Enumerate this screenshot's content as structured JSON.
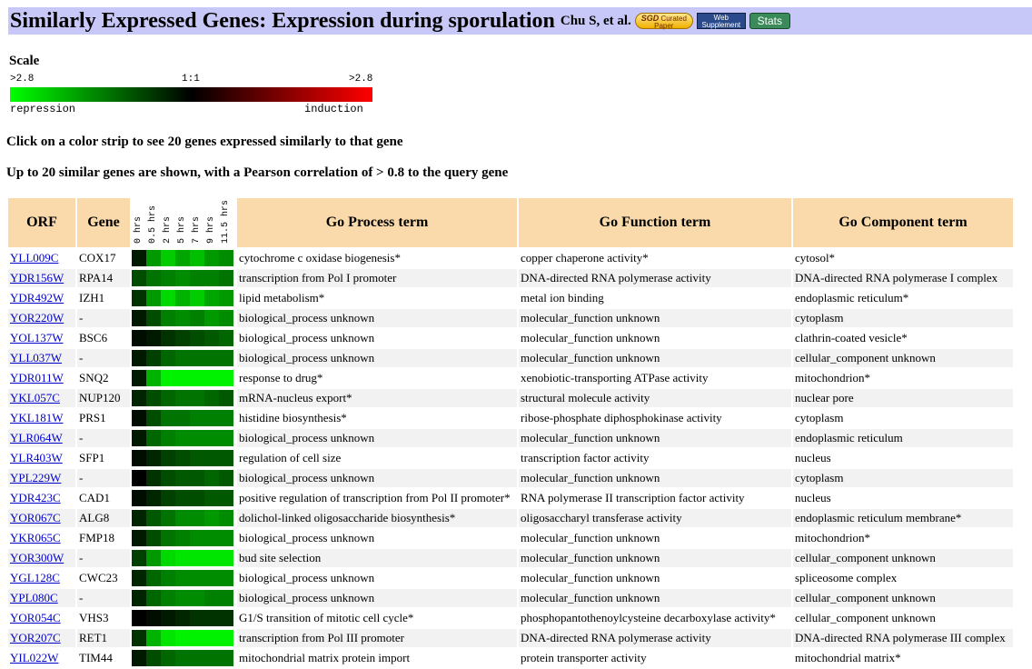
{
  "header": {
    "title": "Similarly Expressed Genes: Expression during sporulation",
    "authors": "Chu S, et al.",
    "sgd_button": {
      "line1": "SGD",
      "line2": "Curated",
      "line3": "Paper"
    },
    "web_button": {
      "line1": "Web",
      "line2": "Supplement"
    },
    "stats_button": "Stats"
  },
  "scale": {
    "label": "Scale",
    "left_value": ">2.8",
    "mid_value": "1:1",
    "right_value": ">2.8",
    "left_text": "repression",
    "right_text": "induction",
    "colors": {
      "repression": "#00ff00",
      "neutral": "#000000",
      "induction": "#ff0000"
    }
  },
  "instructions": {
    "line1": "Click on a color strip to see 20 genes expressed similarly to that gene",
    "line2": "Up to 20 similar genes are shown, with a Pearson correlation of > 0.8 to the query gene"
  },
  "table": {
    "headers": {
      "orf": "ORF",
      "gene": "Gene",
      "process": "Go Process term",
      "function": "Go Function term",
      "component": "Go Component term"
    },
    "timepoints": [
      "0 hrs",
      "0.5 hrs",
      "2 hrs",
      "5 hrs",
      "7 hrs",
      "9 hrs",
      "11.5 hrs"
    ],
    "rows": [
      {
        "orf": "YLL009C",
        "gene": "COX17",
        "process": "cytochrome c oxidase biogenesis*",
        "function": "copper chaperone activity*",
        "component": "cytosol*",
        "strip": [
          0.1,
          0.6,
          0.8,
          0.65,
          0.75,
          0.6,
          0.55
        ]
      },
      {
        "orf": "YDR156W",
        "gene": "RPA14",
        "process": "transcription from Pol I promoter",
        "function": "DNA-directed RNA polymerase activity",
        "component": "DNA-directed RNA polymerase I complex",
        "strip": [
          0.3,
          0.45,
          0.5,
          0.55,
          0.5,
          0.5,
          0.45
        ]
      },
      {
        "orf": "YDR492W",
        "gene": "IZH1",
        "process": "lipid metabolism*",
        "function": "metal ion binding",
        "component": "endoplasmic reticulum*",
        "strip": [
          0.2,
          0.6,
          0.85,
          0.7,
          0.8,
          0.65,
          0.6
        ]
      },
      {
        "orf": "YOR220W",
        "gene": "-",
        "process": "biological_process unknown",
        "function": "molecular_function unknown",
        "component": "cytoplasm",
        "strip": [
          0.1,
          0.3,
          0.5,
          0.55,
          0.5,
          0.6,
          0.55
        ]
      },
      {
        "orf": "YOL137W",
        "gene": "BSC6",
        "process": "biological_process unknown",
        "function": "molecular_function unknown",
        "component": "clathrin-coated vesicle*",
        "strip": [
          0.05,
          0.1,
          0.2,
          0.25,
          0.3,
          0.35,
          0.4
        ]
      },
      {
        "orf": "YLL037W",
        "gene": "-",
        "process": "biological_process unknown",
        "function": "molecular_function unknown",
        "component": "cellular_component unknown",
        "strip": [
          0.1,
          0.25,
          0.4,
          0.45,
          0.45,
          0.45,
          0.45
        ]
      },
      {
        "orf": "YDR011W",
        "gene": "SNQ2",
        "process": "response to drug*",
        "function": "xenobiotic-transporting ATPase activity",
        "component": "mitochondrion*",
        "strip": [
          0.1,
          0.7,
          0.95,
          0.95,
          0.95,
          0.95,
          0.95
        ]
      },
      {
        "orf": "YKL057C",
        "gene": "NUP120",
        "process": "mRNA-nucleus export*",
        "function": "structural molecule activity",
        "component": "nuclear pore",
        "strip": [
          0.15,
          0.3,
          0.4,
          0.45,
          0.45,
          0.4,
          0.35
        ]
      },
      {
        "orf": "YKL181W",
        "gene": "PRS1",
        "process": "histidine biosynthesis*",
        "function": "ribose-phosphate diphosphokinase activity",
        "component": "cytoplasm",
        "strip": [
          0.05,
          0.3,
          0.45,
          0.45,
          0.5,
          0.5,
          0.5
        ]
      },
      {
        "orf": "YLR064W",
        "gene": "-",
        "process": "biological_process unknown",
        "function": "molecular_function unknown",
        "component": "endoplasmic reticulum",
        "strip": [
          0.1,
          0.4,
          0.5,
          0.55,
          0.55,
          0.55,
          0.55
        ]
      },
      {
        "orf": "YLR403W",
        "gene": "SFP1",
        "process": "regulation of cell size",
        "function": "transcription factor activity",
        "component": "nucleus",
        "strip": [
          0.05,
          0.15,
          0.25,
          0.3,
          0.35,
          0.35,
          0.35
        ]
      },
      {
        "orf": "YPL229W",
        "gene": "-",
        "process": "biological_process unknown",
        "function": "molecular_function unknown",
        "component": "cytoplasm",
        "strip": [
          0.0,
          0.2,
          0.3,
          0.35,
          0.35,
          0.4,
          0.35
        ]
      },
      {
        "orf": "YDR423C",
        "gene": "CAD1",
        "process": "positive regulation of transcription from Pol II promoter*",
        "function": "RNA polymerase II transcription factor activity",
        "component": "nucleus",
        "strip": [
          0.05,
          0.15,
          0.25,
          0.3,
          0.3,
          0.35,
          0.35
        ]
      },
      {
        "orf": "YOR067C",
        "gene": "ALG8",
        "process": "dolichol-linked oligosaccharide biosynthesis*",
        "function": "oligosaccharyl transferase activity",
        "component": "endoplasmic reticulum membrane*",
        "strip": [
          0.15,
          0.35,
          0.45,
          0.55,
          0.55,
          0.6,
          0.55
        ]
      },
      {
        "orf": "YKR065C",
        "gene": "FMP18",
        "process": "biological_process unknown",
        "function": "molecular_function unknown",
        "component": "mitochondrion*",
        "strip": [
          0.1,
          0.3,
          0.45,
          0.5,
          0.55,
          0.55,
          0.55
        ]
      },
      {
        "orf": "YOR300W",
        "gene": "-",
        "process": "bud site selection",
        "function": "molecular_function unknown",
        "component": "cellular_component unknown",
        "strip": [
          0.25,
          0.6,
          0.85,
          0.9,
          0.9,
          0.9,
          0.9
        ]
      },
      {
        "orf": "YGL128C",
        "gene": "CWC23",
        "process": "biological_process unknown",
        "function": "molecular_function unknown",
        "component": "spliceosome complex",
        "strip": [
          0.15,
          0.4,
          0.5,
          0.55,
          0.55,
          0.55,
          0.55
        ]
      },
      {
        "orf": "YPL080C",
        "gene": "-",
        "process": "biological_process unknown",
        "function": "molecular_function unknown",
        "component": "cellular_component unknown",
        "strip": [
          0.15,
          0.4,
          0.5,
          0.55,
          0.55,
          0.5,
          0.5
        ]
      },
      {
        "orf": "YOR054C",
        "gene": "VHS3",
        "process": "G1/S transition of mitotic cell cycle*",
        "function": "phosphopantothenoylcysteine decarboxylase activity*",
        "component": "cellular_component unknown",
        "strip": [
          0.0,
          0.05,
          0.1,
          0.15,
          0.2,
          0.2,
          0.2
        ]
      },
      {
        "orf": "YOR207C",
        "gene": "RET1",
        "process": "transcription from Pol III promoter",
        "function": "DNA-directed RNA polymerase activity",
        "component": "DNA-directed RNA polymerase III complex",
        "strip": [
          0.2,
          0.7,
          0.9,
          0.95,
          0.95,
          0.95,
          0.95
        ]
      },
      {
        "orf": "YIL022W",
        "gene": "TIM44",
        "process": "mitochondrial matrix protein import",
        "function": "protein transporter activity",
        "component": "mitochondrial matrix*",
        "strip": [
          0.1,
          0.3,
          0.4,
          0.45,
          0.45,
          0.45,
          0.45
        ]
      }
    ]
  }
}
